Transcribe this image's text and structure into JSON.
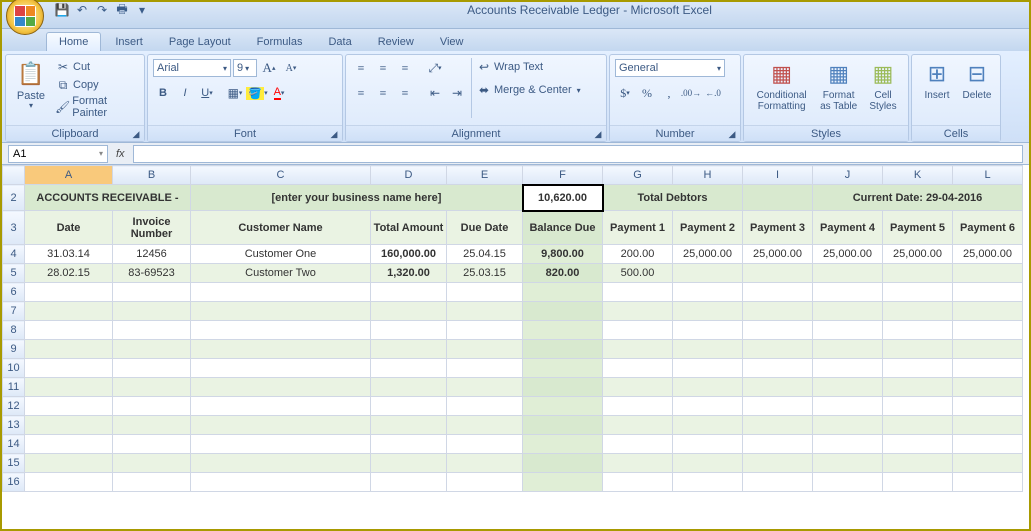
{
  "window": {
    "title": "Accounts Receivable Ledger - Microsoft Excel"
  },
  "tabs": {
    "home": "Home",
    "insert": "Insert",
    "pagelayout": "Page Layout",
    "formulas": "Formulas",
    "data": "Data",
    "review": "Review",
    "view": "View"
  },
  "ribbon": {
    "clipboard": {
      "paste": "Paste",
      "cut": "Cut",
      "copy": "Copy",
      "fmtpainter": "Format Painter",
      "label": "Clipboard"
    },
    "font": {
      "name": "Arial",
      "size": "9",
      "label": "Font"
    },
    "alignment": {
      "wrap": "Wrap Text",
      "merge": "Merge & Center",
      "label": "Alignment"
    },
    "number": {
      "format": "General",
      "label": "Number"
    },
    "styles": {
      "cond": "Conditional Formatting",
      "fmt": "Format as Table",
      "cell": "Cell Styles",
      "label": "Styles"
    },
    "cells": {
      "insert": "Insert",
      "delete": "Delete",
      "label": "Cells"
    }
  },
  "fbar": {
    "namebox": "A1"
  },
  "cols": [
    "A",
    "B",
    "C",
    "D",
    "E",
    "F",
    "G",
    "H",
    "I",
    "J",
    "K",
    "L"
  ],
  "header2": {
    "title": "ACCOUNTS RECEIVABLE - ",
    "placeholder": "[enter your business name here]",
    "sum": "10,620.00",
    "totaldebt": "Total Debtors",
    "curdate": "Current Date: 29-04-2016"
  },
  "header3": {
    "date": "Date",
    "inv": "Invoice Number",
    "cust": "Customer Name",
    "total": "Total Amount",
    "due": "Due Date",
    "bal": "Balance Due",
    "p1": "Payment 1",
    "p2": "Payment 2",
    "p3": "Payment 3",
    "p4": "Payment 4",
    "p5": "Payment 5",
    "p6": "Payment 6"
  },
  "rows": [
    {
      "date": "31.03.14",
      "inv": "12456",
      "cust": "Customer One",
      "total": "160,000.00",
      "due": "25.04.15",
      "bal": "9,800.00",
      "p1": "200.00",
      "p2": "25,000.00",
      "p3": "25,000.00",
      "p4": "25,000.00",
      "p5": "25,000.00",
      "p6": "25,000.00"
    },
    {
      "date": "28.02.15",
      "inv": "83-69523",
      "cust": "Customer Two",
      "total": "1,320.00",
      "due": "25.03.15",
      "bal": "820.00",
      "p1": "500.00",
      "p2": "",
      "p3": "",
      "p4": "",
      "p5": "",
      "p6": ""
    }
  ]
}
